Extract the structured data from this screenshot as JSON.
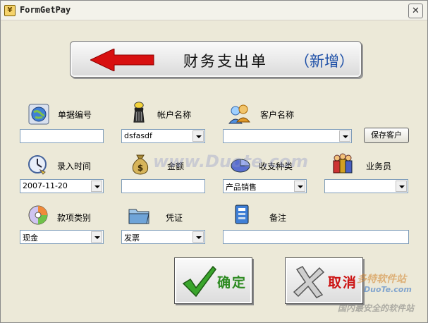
{
  "window": {
    "title": "FormGetPay",
    "close_glyph": "✕",
    "app_icon_glyph": "¥"
  },
  "banner": {
    "title": "财务支出单",
    "mode": "（新增）",
    "arrow_icon": "back-arrow-icon",
    "arrow_color": "#d81010"
  },
  "fields": {
    "bill_no": {
      "label": "单据编号",
      "value": ""
    },
    "account_name": {
      "label": "帐户名称",
      "value": "dsfasdf"
    },
    "customer_name": {
      "label": "客户名称",
      "value": ""
    },
    "save_customer": "保存客户",
    "entry_time": {
      "label": "录入时间",
      "value": "2007-11-20"
    },
    "amount": {
      "label": "金额",
      "value": ""
    },
    "income_type": {
      "label": "收支种类",
      "value": "产品销售"
    },
    "salesperson": {
      "label": "业务员",
      "value": ""
    },
    "payment_category": {
      "label": "款项类别",
      "value": "现金"
    },
    "voucher": {
      "label": "凭证",
      "value": "发票"
    },
    "remark": {
      "label": "备注",
      "value": ""
    }
  },
  "buttons": {
    "ok": {
      "label": "确定",
      "color": "#2e8b22"
    },
    "cancel": {
      "label": "取消",
      "color": "#cc1111"
    }
  },
  "watermarks": {
    "center": "www.Duote.com",
    "site_name": "多特软件站",
    "site_url": "DuoTe.com",
    "slogan": "国内最安全的软件站"
  }
}
